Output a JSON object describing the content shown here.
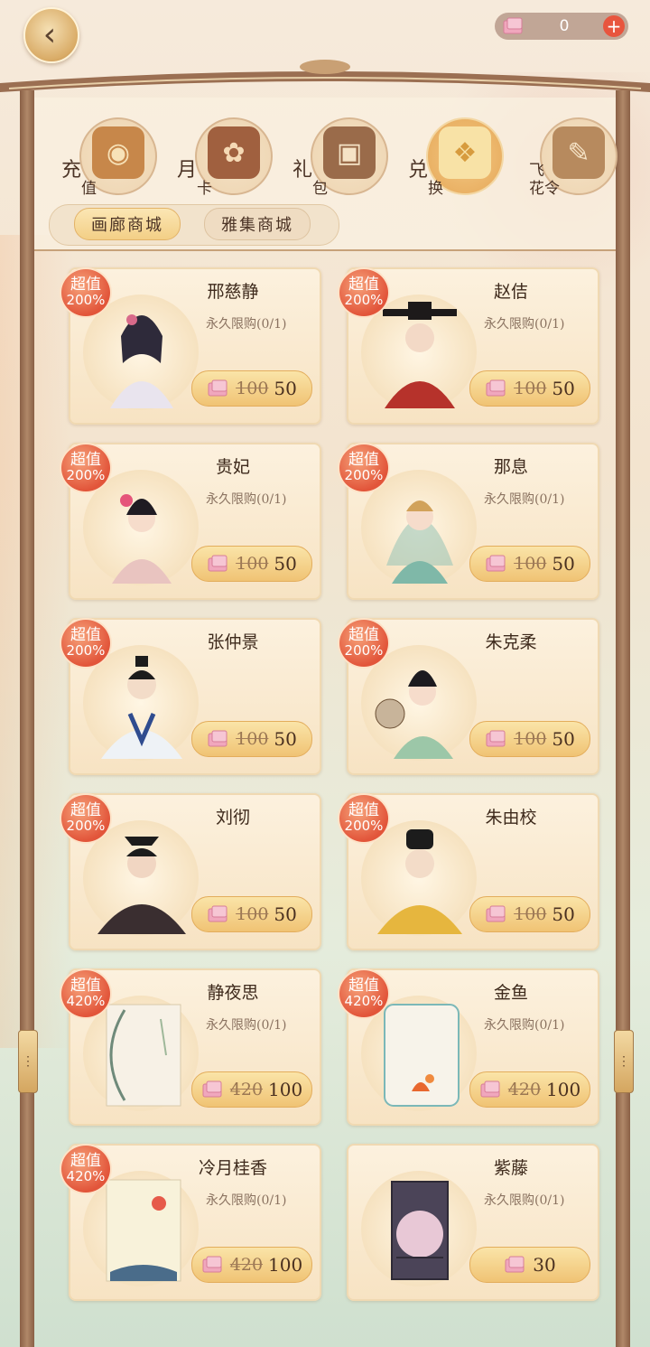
{
  "currency": {
    "count": "0",
    "plus_label": "+"
  },
  "tabs": [
    {
      "c1": "充",
      "c2": "值",
      "icon": "coin-icon",
      "glyph": "◉"
    },
    {
      "c1": "月",
      "c2": "卡",
      "icon": "card-icon",
      "glyph": "✿"
    },
    {
      "c1": "礼",
      "c2": "包",
      "icon": "gift-box-icon",
      "glyph": "▣"
    },
    {
      "c1": "兑",
      "c2": "换",
      "icon": "exchange-gift-icon",
      "glyph": "❖"
    },
    {
      "c1": "飞",
      "c2": "花令",
      "icon": "scroll-icon",
      "glyph": "✎"
    }
  ],
  "subtabs": {
    "active": "画廊商城",
    "inactive": "雅集商城"
  },
  "badge": {
    "title": "超值"
  },
  "items": [
    {
      "name": "邢慈静",
      "limit": "永久限购(0/1)",
      "old_price": "100",
      "price": "50",
      "badge_pct": "200%"
    },
    {
      "name": "赵佶",
      "limit": "永久限购(0/1)",
      "old_price": "100",
      "price": "50",
      "badge_pct": "200%"
    },
    {
      "name": "贵妃",
      "limit": "永久限购(0/1)",
      "old_price": "100",
      "price": "50",
      "badge_pct": "200%"
    },
    {
      "name": "那息",
      "limit": "永久限购(0/1)",
      "old_price": "100",
      "price": "50",
      "badge_pct": "200%"
    },
    {
      "name": "张仲景",
      "limit": "",
      "old_price": "100",
      "price": "50",
      "badge_pct": "200%"
    },
    {
      "name": "朱克柔",
      "limit": "",
      "old_price": "100",
      "price": "50",
      "badge_pct": "200%"
    },
    {
      "name": "刘彻",
      "limit": "",
      "old_price": "100",
      "price": "50",
      "badge_pct": "200%"
    },
    {
      "name": "朱由校",
      "limit": "",
      "old_price": "100",
      "price": "50",
      "badge_pct": "200%"
    },
    {
      "name": "静夜思",
      "limit": "永久限购(0/1)",
      "old_price": "420",
      "price": "100",
      "badge_pct": "420%"
    },
    {
      "name": "金鱼",
      "limit": "永久限购(0/1)",
      "old_price": "420",
      "price": "100",
      "badge_pct": "420%"
    },
    {
      "name": "冷月桂香",
      "limit": "永久限购(0/1)",
      "old_price": "420",
      "price": "100",
      "badge_pct": "420%"
    },
    {
      "name": "紫藤",
      "limit": "永久限购(0/1)",
      "old_price": "",
      "price": "30",
      "badge_pct": ""
    }
  ]
}
